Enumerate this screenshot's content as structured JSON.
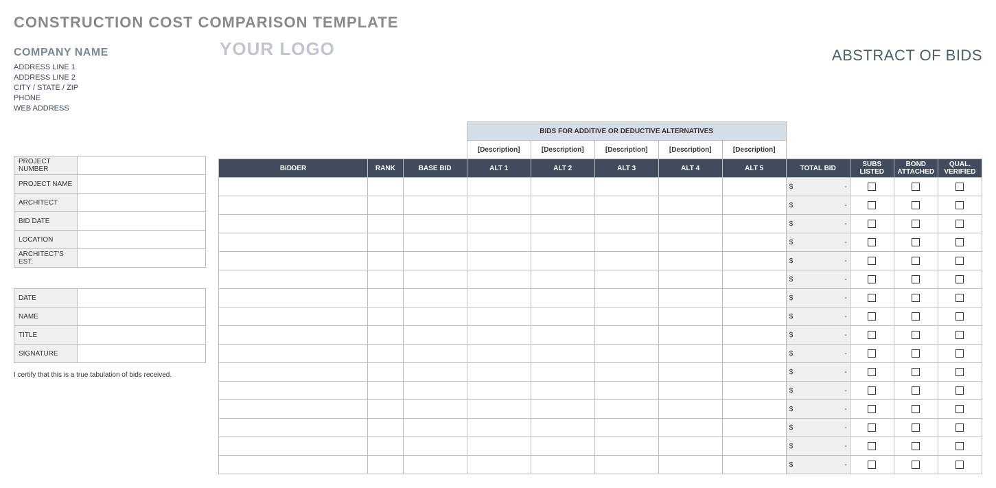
{
  "title": "CONSTRUCTION COST COMPARISON TEMPLATE",
  "company": {
    "name": "COMPANY NAME",
    "lines": [
      "ADDRESS LINE 1",
      "ADDRESS LINE 2",
      "CITY / STATE / ZIP",
      "PHONE",
      "WEB ADDRESS"
    ]
  },
  "logo_text": "YOUR LOGO",
  "header_right": "ABSTRACT OF BIDS",
  "info1_labels": [
    "PROJECT NUMBER",
    "PROJECT NAME",
    "ARCHITECT",
    "BID DATE",
    "LOCATION",
    "ARCHITECT'S EST."
  ],
  "info2_labels": [
    "DATE",
    "NAME",
    "TITLE",
    "SIGNATURE"
  ],
  "certify": "I certify that this is a true tabulation of bids received.",
  "bidtable": {
    "alt_group": "BIDS FOR ADDITIVE OR DEDUCTIVE ALTERNATIVES",
    "desc_placeholder": "[Description]",
    "headers": {
      "bidder": "BIDDER",
      "rank": "RANK",
      "base": "BASE BID",
      "alts": [
        "ALT 1",
        "ALT 2",
        "ALT 3",
        "ALT 4",
        "ALT 5"
      ],
      "total": "TOTAL BID",
      "subs": "SUBS LISTED",
      "bond": "BOND ATTACHED",
      "qual": "QUAL. VERIFIED"
    },
    "total_value": {
      "currency": "$",
      "dash": "-"
    },
    "row_count": 16
  }
}
